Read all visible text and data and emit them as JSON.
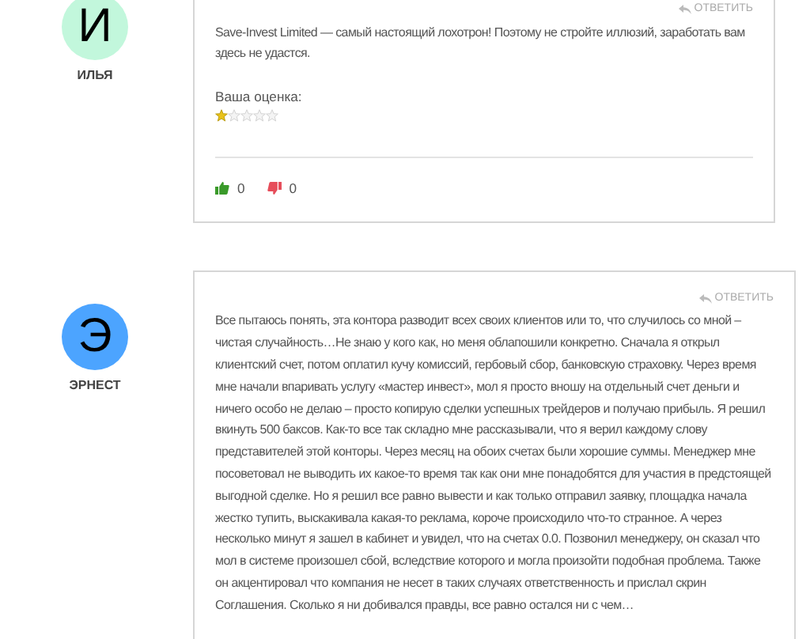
{
  "comments": [
    {
      "avatar_letter": "И",
      "color": "#c2f7dc",
      "author": "ИЛЬЯ",
      "reply": "ОТВЕТИТЬ",
      "text": "Save-Invest Limited — самый настоящий лохотрон! Поэтому не стройте иллюзий, заработать вам здесь не удастся.",
      "rating_label": "Ваша оценка:",
      "stars": 1,
      "likes": "0",
      "dislikes": "0"
    },
    {
      "avatar_letter": "Э",
      "color": "#4ca4ff",
      "author": "ЭРНЕСТ",
      "reply": "ОТВЕТИТЬ",
      "text": "Все пытаюсь понять, эта контора разводит всех своих клиентов или то, что случилось со мной – чистая случайность…Не знаю у кого как, но меня облапошили конкретно. Сначала я открыл клиентский счет, потом оплатил кучу комиссий, гербовый сбор, банковскую страховку. Через время мне начали впаривать услугу «мастер инвест», мол я просто вношу на отдельный счет деньги и ничего особо не делаю – просто копирую сделки успешных трейдеров и получаю прибыль. Я решил вкинуть 500 баксов. Как-то все так складно мне рассказывали, что я верил каждому слову представителей этой конторы. Через месяц на обоих счетах были хорошие суммы. Менеджер мне посоветовал не выводить их какое-то время так как они мне понадобятся для участия в предстоящей выгодной сделке. Но я решил все равно вывести и как только отправил заявку, площадка начала жестко тупить, выскакивала какая-то реклама, короче происходило что-то странное. А через несколько минут я зашел в кабинет и увидел, что на счетах 0.0. Позвонил менеджеру, он сказал что мол в системе произошел сбой, вследствие которого и могла произойти подобная проблема. Также он акцентировал что компания не несет в таких случаях ответственность и прислал скрин Соглашения. Сколько я ни добивался правды, все равно остался ни с чем…"
    }
  ]
}
